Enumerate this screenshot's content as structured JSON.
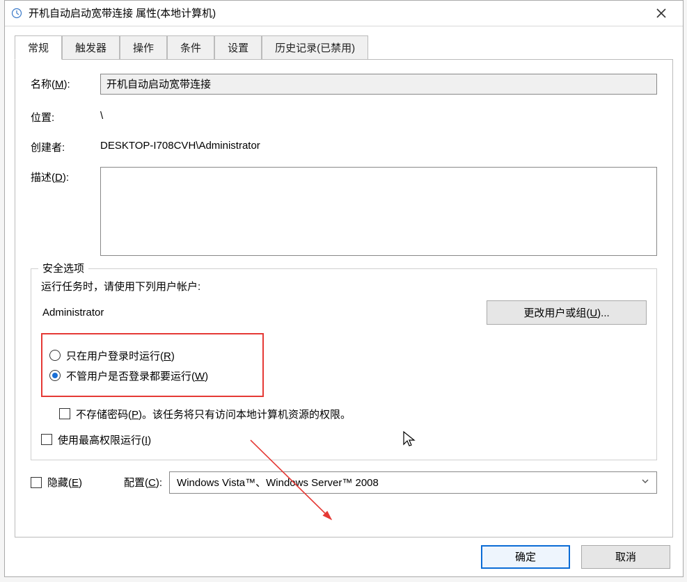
{
  "window": {
    "title": "开机自动启动宽带连接 属性(本地计算机)"
  },
  "tabs": {
    "general": "常规",
    "triggers": "触发器",
    "actions": "操作",
    "conditions": "条件",
    "settings": "设置",
    "history": "历史记录(已禁用)"
  },
  "general": {
    "name_label": "名称(M):",
    "name_value": "开机自动启动宽带连接",
    "location_label": "位置:",
    "location_value": "\\",
    "creator_label": "创建者:",
    "creator_value": "DESKTOP-I708CVH\\Administrator",
    "description_label": "描述(D):",
    "description_value": ""
  },
  "security": {
    "legend": "安全选项",
    "run_as_label": "运行任务时，请使用下列用户帐户:",
    "account": "Administrator",
    "change_btn": "更改用户或组(U)...",
    "radio_logged_on": "只在用户登录时运行(R)",
    "radio_any": "不管用户是否登录都要运行(W)",
    "no_password": "不存储密码(P)。该任务将只有访问本地计算机资源的权限。",
    "highest_priv": "使用最高权限运行(I)"
  },
  "bottom": {
    "hidden_label": "隐藏(E)",
    "configure_label": "配置(C):",
    "configure_value": "Windows Vista™、Windows Server™ 2008"
  },
  "footer": {
    "ok": "确定",
    "cancel": "取消"
  }
}
